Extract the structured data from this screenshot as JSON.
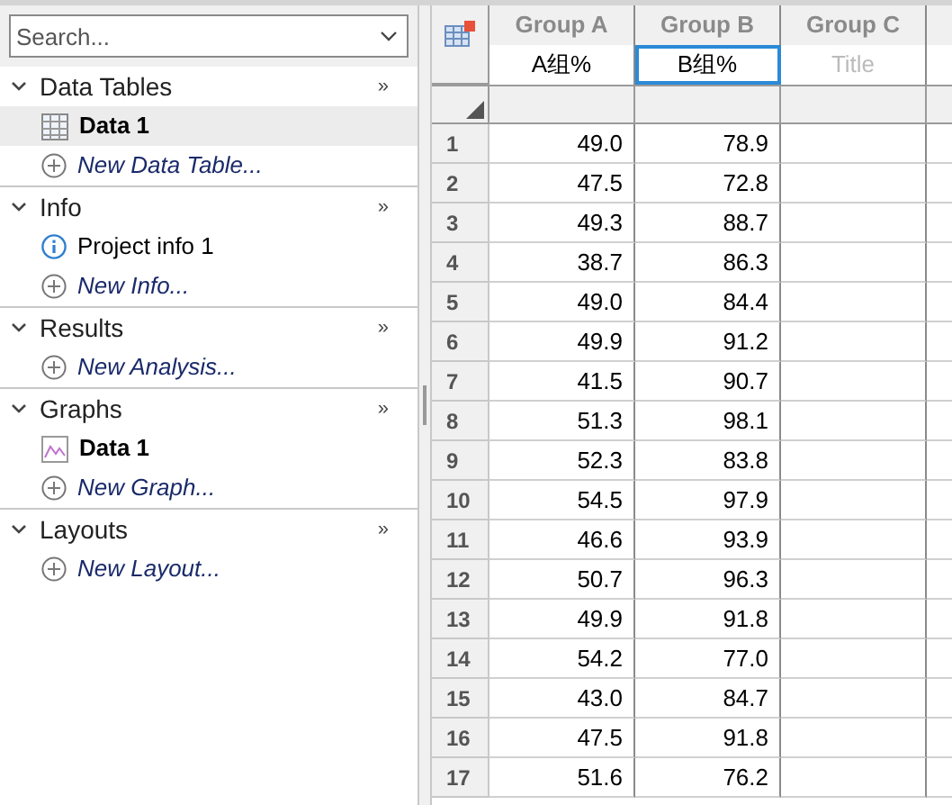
{
  "sidebar": {
    "search": {
      "placeholder": "Search..."
    },
    "sections": [
      {
        "title": "Data Tables",
        "more": "»",
        "expanded": true,
        "items": [
          {
            "kind": "table",
            "label": "Data 1",
            "selected": true
          },
          {
            "kind": "new",
            "label": "New Data Table...",
            "selected": false
          }
        ]
      },
      {
        "title": "Info",
        "more": "»",
        "expanded": true,
        "items": [
          {
            "kind": "info",
            "label": "Project info 1",
            "selected": false
          },
          {
            "kind": "new",
            "label": "New Info...",
            "selected": false
          }
        ]
      },
      {
        "title": "Results",
        "more": "»",
        "expanded": true,
        "items": [
          {
            "kind": "new",
            "label": "New Analysis...",
            "selected": false
          }
        ]
      },
      {
        "title": "Graphs",
        "more": "»",
        "expanded": true,
        "items": [
          {
            "kind": "graph",
            "label": "Data 1",
            "selected": false
          },
          {
            "kind": "new",
            "label": "New Graph...",
            "selected": false
          }
        ]
      },
      {
        "title": "Layouts",
        "more": "»",
        "expanded": true,
        "items": [
          {
            "kind": "new",
            "label": "New Layout...",
            "selected": false
          }
        ]
      }
    ]
  },
  "table": {
    "columns": [
      {
        "group": "Group A",
        "title": "A组%",
        "focused": false
      },
      {
        "group": "Group B",
        "title": "B组%",
        "focused": true
      },
      {
        "group": "Group C",
        "placeholder": "Title",
        "focused": false
      }
    ],
    "rows": [
      {
        "number": "1",
        "values": [
          "49.0",
          "78.9"
        ]
      },
      {
        "number": "2",
        "values": [
          "47.5",
          "72.8"
        ]
      },
      {
        "number": "3",
        "values": [
          "49.3",
          "88.7"
        ]
      },
      {
        "number": "4",
        "values": [
          "38.7",
          "86.3"
        ]
      },
      {
        "number": "5",
        "values": [
          "49.0",
          "84.4"
        ]
      },
      {
        "number": "6",
        "values": [
          "49.9",
          "91.2"
        ]
      },
      {
        "number": "7",
        "values": [
          "41.5",
          "90.7"
        ]
      },
      {
        "number": "8",
        "values": [
          "51.3",
          "98.1"
        ]
      },
      {
        "number": "9",
        "values": [
          "52.3",
          "83.8"
        ]
      },
      {
        "number": "10",
        "values": [
          "54.5",
          "97.9"
        ]
      },
      {
        "number": "11",
        "values": [
          "46.6",
          "93.9"
        ]
      },
      {
        "number": "12",
        "values": [
          "50.7",
          "96.3"
        ]
      },
      {
        "number": "13",
        "values": [
          "49.9",
          "91.8"
        ]
      },
      {
        "number": "14",
        "values": [
          "54.2",
          "77.0"
        ]
      },
      {
        "number": "15",
        "values": [
          "43.0",
          "84.7"
        ]
      },
      {
        "number": "16",
        "values": [
          "47.5",
          "91.8"
        ]
      },
      {
        "number": "17",
        "values": [
          "51.6",
          "76.2"
        ]
      }
    ]
  }
}
